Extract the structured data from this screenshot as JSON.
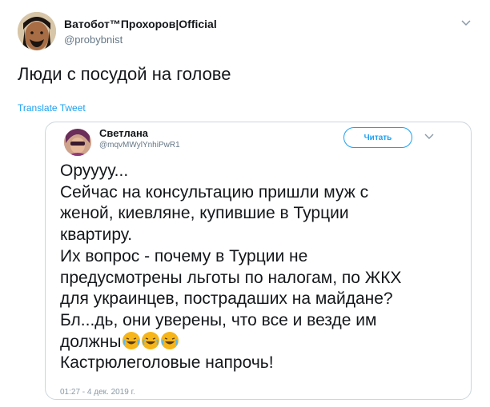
{
  "tweet": {
    "display_name": "Ватобот™Прохоров|Official",
    "handle": "@probybnist",
    "text": "Люди с посудой на голове",
    "translate_label": "Translate Tweet",
    "caret_icon": "chevron-down-icon"
  },
  "quoted_tweet": {
    "display_name": "Светлана",
    "handle": "@mqvMWylYnhiPwR1",
    "follow_label": "Читать",
    "lines": [
      "Оруууу...",
      "Сейчас на консультацию пришли муж с",
      "женой, киевляне, купившие в Турции",
      "квартиру.",
      "Их вопрос - почему в Турции не",
      "предусмотрены льготы по налогам, по ЖКХ",
      "для украинцев, пострадаших на майдане?",
      "Бл...дь, они уверены, что все и везде им",
      "должны",
      "Кастрюлеголовые напрочь!"
    ],
    "emoji": [
      "rolling-on-floor-laughing-emoji",
      "rolling-on-floor-laughing-emoji",
      "rolling-on-floor-laughing-emoji"
    ],
    "timestamp": "01:27 - 4 дек. 2019 г."
  },
  "colors": {
    "text": "#14171a",
    "secondary": "#657786",
    "accent": "#1da1f2",
    "border": "#ccd6dd"
  }
}
